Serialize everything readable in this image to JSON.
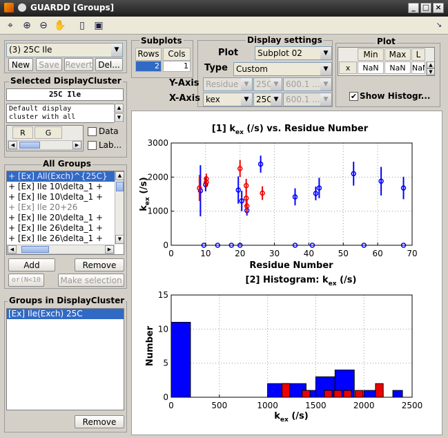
{
  "window": {
    "title": "GUARDD [Groups]"
  },
  "toolbar": {
    "icons": [
      "edit-plot-icon",
      "zoom-in-icon",
      "zoom-out-icon",
      "pan-hand-icon",
      "new-document-icon",
      "save-disk-icon"
    ]
  },
  "group_selector": {
    "value": "(3) 25C Ile"
  },
  "buttons": {
    "new": "New",
    "save": "Save",
    "revert": "Revert",
    "delete": "Del...",
    "add": "Add",
    "remove": "Remove",
    "or_n": "or(N<10",
    "make_selection": "Make selection",
    "remove2": "Remove"
  },
  "selected_cluster": {
    "title": "Selected DisplayCluster",
    "name": "25C Ile",
    "description": "Default display\ncluster with all",
    "color_headers": [
      "R",
      "G"
    ],
    "data_label": "Data",
    "labels_label": "Lab..."
  },
  "all_groups": {
    "title": "All Groups",
    "items": [
      "+ [Ex] All(Exch)^{25C}",
      "+ [Ex] Ile 10\\delta_1 +",
      "+ [Ex] Ile 10\\delta_1 +",
      "+ [Ex] Ile 20+26",
      "+ [Ex] Ile 20\\delta_1 +",
      "+ [Ex] Ile 26\\delta_1 +",
      "+ [Ex] Ile 26\\delta_1 +"
    ]
  },
  "groups_in_cluster": {
    "title": "Groups in DisplayCluster",
    "items": [
      "[Ex] Ile(Exch) 25C"
    ]
  },
  "subplots": {
    "title": "Subplots",
    "rows_label": "Rows",
    "cols_label": "Cols",
    "rows": "2",
    "cols": "1"
  },
  "display_settings": {
    "title": "Display settings",
    "plot_label": "Plot",
    "plot_value": "Subplot 02",
    "type_label": "Type",
    "type_value": "Custom",
    "yaxis_label": "Y-Axis",
    "y_var": "Residue",
    "y_temp": "25C",
    "y_field": "600.1 ...",
    "xaxis_label": "X-Axis",
    "x_var": "kex",
    "x_temp": "25C",
    "x_field": "600.1 ..."
  },
  "plot_panel": {
    "title": "Plot",
    "headers": [
      "Min",
      "Max",
      "L"
    ],
    "row_label": "x",
    "row_values": [
      "NaN",
      "NaN",
      "NaN"
    ],
    "show_histogram": "Show Histogr..."
  },
  "colors": {
    "blue": "#0000ff",
    "red": "#ee0000",
    "selection": "#316ac5"
  },
  "chart_data": [
    {
      "type": "scatter",
      "title": "[1] k_ex (/s) vs. Residue Number",
      "title_main": "[1] k",
      "title_sub": "ex",
      "title_rest": " (/s) vs. Residue Number",
      "xlabel": "Residue Number",
      "ylabel_main": "k",
      "ylabel_sub": "ex",
      "ylabel_rest": " (/s)",
      "xlim": [
        0,
        70
      ],
      "ylim": [
        0,
        3000
      ],
      "xticks": [
        0,
        10,
        20,
        30,
        40,
        50,
        60,
        70
      ],
      "yticks": [
        0,
        1000,
        2000,
        3000
      ],
      "grid": true,
      "series": [
        {
          "color": "blue",
          "points": [
            {
              "x": 8.5,
              "y": 1600,
              "err": 750
            },
            {
              "x": 10,
              "y": 1780,
              "err": 200
            },
            {
              "x": 19.5,
              "y": 1620,
              "err": 400
            },
            {
              "x": 20.5,
              "y": 1300,
              "err": 300
            },
            {
              "x": 22,
              "y": 1020,
              "err": 150
            },
            {
              "x": 26,
              "y": 2380,
              "err": 250
            },
            {
              "x": 36,
              "y": 1420,
              "err": 250
            },
            {
              "x": 42,
              "y": 1520,
              "err": 200
            },
            {
              "x": 43,
              "y": 1680,
              "err": 300
            },
            {
              "x": 53,
              "y": 2100,
              "err": 350
            },
            {
              "x": 61,
              "y": 1880,
              "err": 420
            },
            {
              "x": 67.5,
              "y": 1680,
              "err": 330
            },
            {
              "x": 9.5,
              "y": 0,
              "err": 0
            },
            {
              "x": 13.5,
              "y": 0,
              "err": 0
            },
            {
              "x": 17.5,
              "y": 0,
              "err": 0
            },
            {
              "x": 20,
              "y": 0,
              "err": 0
            },
            {
              "x": 36,
              "y": 0,
              "err": 0
            },
            {
              "x": 41,
              "y": 0,
              "err": 0
            },
            {
              "x": 56,
              "y": 0,
              "err": 0
            },
            {
              "x": 67.5,
              "y": 0,
              "err": 0
            }
          ]
        },
        {
          "color": "red",
          "points": [
            {
              "x": 8.2,
              "y": 1680,
              "err": 380
            },
            {
              "x": 10.2,
              "y": 1950,
              "err": 150
            },
            {
              "x": 10.2,
              "y": 1850,
              "err": 150
            },
            {
              "x": 20,
              "y": 2250,
              "err": 250
            },
            {
              "x": 21.8,
              "y": 1750,
              "err": 200
            },
            {
              "x": 21.8,
              "y": 1380,
              "err": 250
            },
            {
              "x": 22,
              "y": 1150,
              "err": 200
            },
            {
              "x": 26.5,
              "y": 1530,
              "err": 200
            }
          ]
        }
      ]
    },
    {
      "type": "bar",
      "title": "[2] Histogram: k_ex (/s)",
      "title_main": "[2] Histogram: k",
      "title_sub": "ex",
      "title_rest": " (/s)",
      "xlabel_main": "k",
      "xlabel_sub": "ex",
      "xlabel_rest": " (/s)",
      "ylabel": "Number",
      "xlim": [
        0,
        2500
      ],
      "ylim": [
        0,
        15
      ],
      "xticks": [
        0,
        500,
        1000,
        1500,
        2000,
        2500
      ],
      "yticks": [
        0,
        5,
        10,
        15
      ],
      "grid": true,
      "bars": [
        {
          "series": "blue",
          "x0": 0,
          "x1": 200,
          "value": 11
        },
        {
          "series": "blue",
          "x0": 1000,
          "x1": 1200,
          "value": 2
        },
        {
          "series": "blue",
          "x0": 1200,
          "x1": 1400,
          "value": 2
        },
        {
          "series": "blue",
          "x0": 1400,
          "x1": 1600,
          "value": 1
        },
        {
          "series": "blue",
          "x0": 1500,
          "x1": 1700,
          "value": 3
        },
        {
          "series": "blue",
          "x0": 1700,
          "x1": 1900,
          "value": 4
        },
        {
          "series": "blue",
          "x0": 2000,
          "x1": 2200,
          "value": 1
        },
        {
          "series": "blue",
          "x0": 2300,
          "x1": 2400,
          "value": 1
        },
        {
          "series": "red",
          "x0": 1150,
          "x1": 1230,
          "value": 2
        },
        {
          "series": "red",
          "x0": 1360,
          "x1": 1440,
          "value": 1
        },
        {
          "series": "red",
          "x0": 1590,
          "x1": 1670,
          "value": 1
        },
        {
          "series": "red",
          "x0": 1690,
          "x1": 1770,
          "value": 1
        },
        {
          "series": "red",
          "x0": 1790,
          "x1": 1870,
          "value": 1
        },
        {
          "series": "red",
          "x0": 1910,
          "x1": 1990,
          "value": 1
        },
        {
          "series": "red",
          "x0": 2120,
          "x1": 2200,
          "value": 2
        }
      ]
    }
  ]
}
